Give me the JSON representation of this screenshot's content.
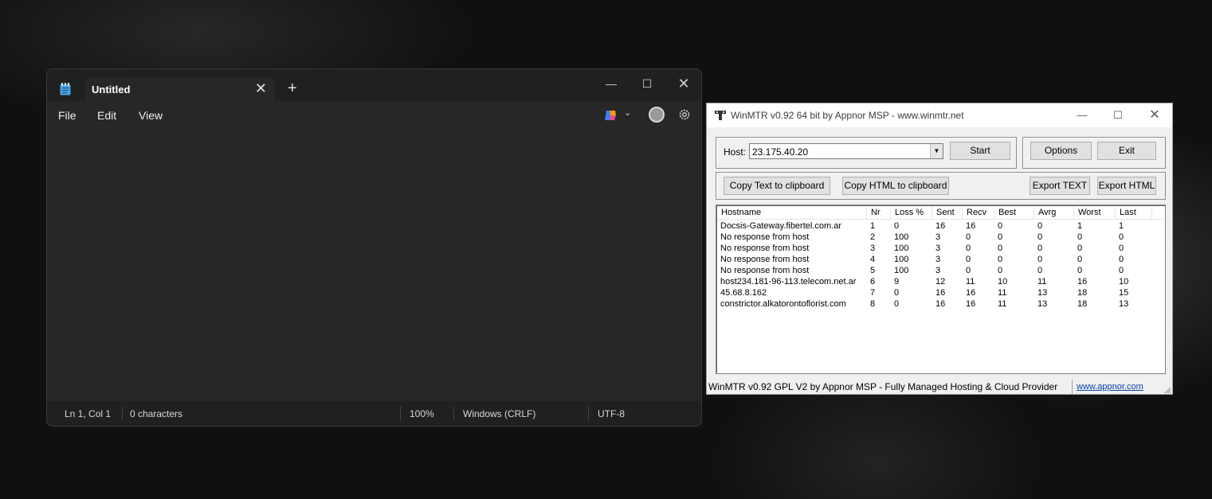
{
  "notepad": {
    "tab_title": "Untitled",
    "menu": [
      "File",
      "Edit",
      "View"
    ],
    "status": {
      "position": "Ln 1, Col 1",
      "characters": "0 characters",
      "zoom": "100%",
      "line_ending": "Windows (CRLF)",
      "encoding": "UTF-8"
    }
  },
  "winmtr": {
    "title": "WinMTR v0.92 64 bit by Appnor MSP - www.winmtr.net",
    "host_label": "Host:",
    "host_value": "23.175.40.20",
    "buttons": {
      "start": "Start",
      "options": "Options",
      "exit": "Exit",
      "copy_text": "Copy Text to clipboard",
      "copy_html": "Copy HTML to clipboard",
      "export_text": "Export TEXT",
      "export_html": "Export HTML"
    },
    "columns": [
      "Hostname",
      "Nr",
      "Loss %",
      "Sent",
      "Recv",
      "Best",
      "Avrg",
      "Worst",
      "Last"
    ],
    "rows": [
      [
        "Docsis-Gateway.fibertel.com.ar",
        "1",
        "0",
        "16",
        "16",
        "0",
        "0",
        "1",
        "1"
      ],
      [
        "No response from host",
        "2",
        "100",
        "3",
        "0",
        "0",
        "0",
        "0",
        "0"
      ],
      [
        "No response from host",
        "3",
        "100",
        "3",
        "0",
        "0",
        "0",
        "0",
        "0"
      ],
      [
        "No response from host",
        "4",
        "100",
        "3",
        "0",
        "0",
        "0",
        "0",
        "0"
      ],
      [
        "No response from host",
        "5",
        "100",
        "3",
        "0",
        "0",
        "0",
        "0",
        "0"
      ],
      [
        "host234.181-96-113.telecom.net.ar",
        "6",
        "9",
        "12",
        "11",
        "10",
        "11",
        "16",
        "10"
      ],
      [
        "45.68.8.162",
        "7",
        "0",
        "16",
        "16",
        "11",
        "13",
        "18",
        "15"
      ],
      [
        "constrictor.alkatorontoflorist.com",
        "8",
        "0",
        "16",
        "16",
        "11",
        "13",
        "18",
        "13"
      ]
    ],
    "status_text": "WinMTR v0.92 GPL V2 by Appnor MSP - Fully Managed Hosting & Cloud Provider",
    "status_link": "www.appnor.com"
  }
}
